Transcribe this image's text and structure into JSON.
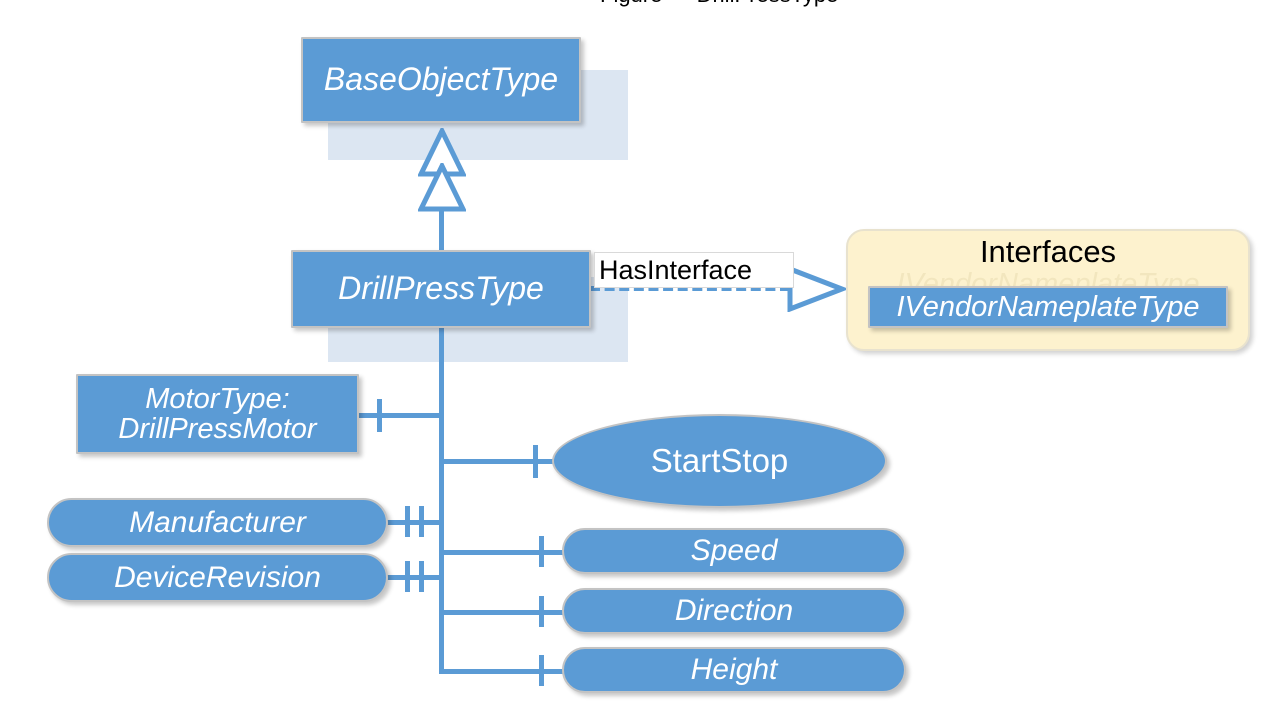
{
  "diagram": {
    "clipped_caption": "Figure — DrillPressType",
    "nodes": {
      "base_object_type": {
        "label": "BaseObjectType"
      },
      "drill_press_type": {
        "label": "DrillPressType"
      },
      "motor_type": {
        "label_line1": "MotorType:",
        "label_line2": "DrillPressMotor"
      },
      "manufacturer": {
        "label": "Manufacturer"
      },
      "device_revision": {
        "label": "DeviceRevision"
      },
      "start_stop": {
        "label": "StartStop"
      },
      "speed": {
        "label": "Speed"
      },
      "direction": {
        "label": "Direction"
      },
      "height": {
        "label": "Height"
      }
    },
    "interfaces_panel": {
      "title": "Interfaces",
      "ghost_text": "IVendorNameplateType",
      "items": [
        {
          "label": "IVendorNameplateType"
        }
      ]
    },
    "edges": {
      "has_interface": {
        "label": "HasInterface"
      }
    },
    "colors": {
      "node_fill": "#5B9BD5",
      "node_border": "#C3C3C3",
      "node_text": "#FFFFFF",
      "connector": "#5B9BD5",
      "ghost_panel": "#DCE6F2",
      "interfaces_panel_fill": "#FDF2CE",
      "interfaces_panel_border": "#E8E2CE",
      "label_text": "#000000",
      "background": "#FFFFFF"
    }
  }
}
